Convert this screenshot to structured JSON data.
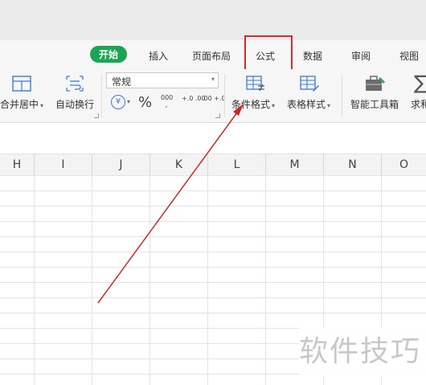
{
  "tabs": [
    {
      "label": "开始",
      "active": true
    },
    {
      "label": "插入"
    },
    {
      "label": "页面布局"
    },
    {
      "label": "公式",
      "highlighted": true
    },
    {
      "label": "数据"
    },
    {
      "label": "审阅"
    },
    {
      "label": "视图"
    }
  ],
  "ribbon": {
    "merge_center": "合并居中",
    "auto_wrap": "自动换行",
    "number_format": "常规",
    "currency_symbol": "¥",
    "percent_symbol": "%",
    "thousands_symbol": "000",
    "increase_decimal": "+.0 .00",
    "decrease_decimal": ".00 +.0",
    "conditional_format": "条件格式",
    "table_style": "表格样式",
    "smart_toolbox": "智能工具箱",
    "sum_partial": "求和"
  },
  "columns": [
    "H",
    "I",
    "J",
    "K",
    "L",
    "M",
    "N",
    "O"
  ],
  "watermark": "软件技巧",
  "colors": {
    "accent_green": "#1aa553",
    "highlight_red": "#d12b2b",
    "arrow_red": "#c62828"
  }
}
